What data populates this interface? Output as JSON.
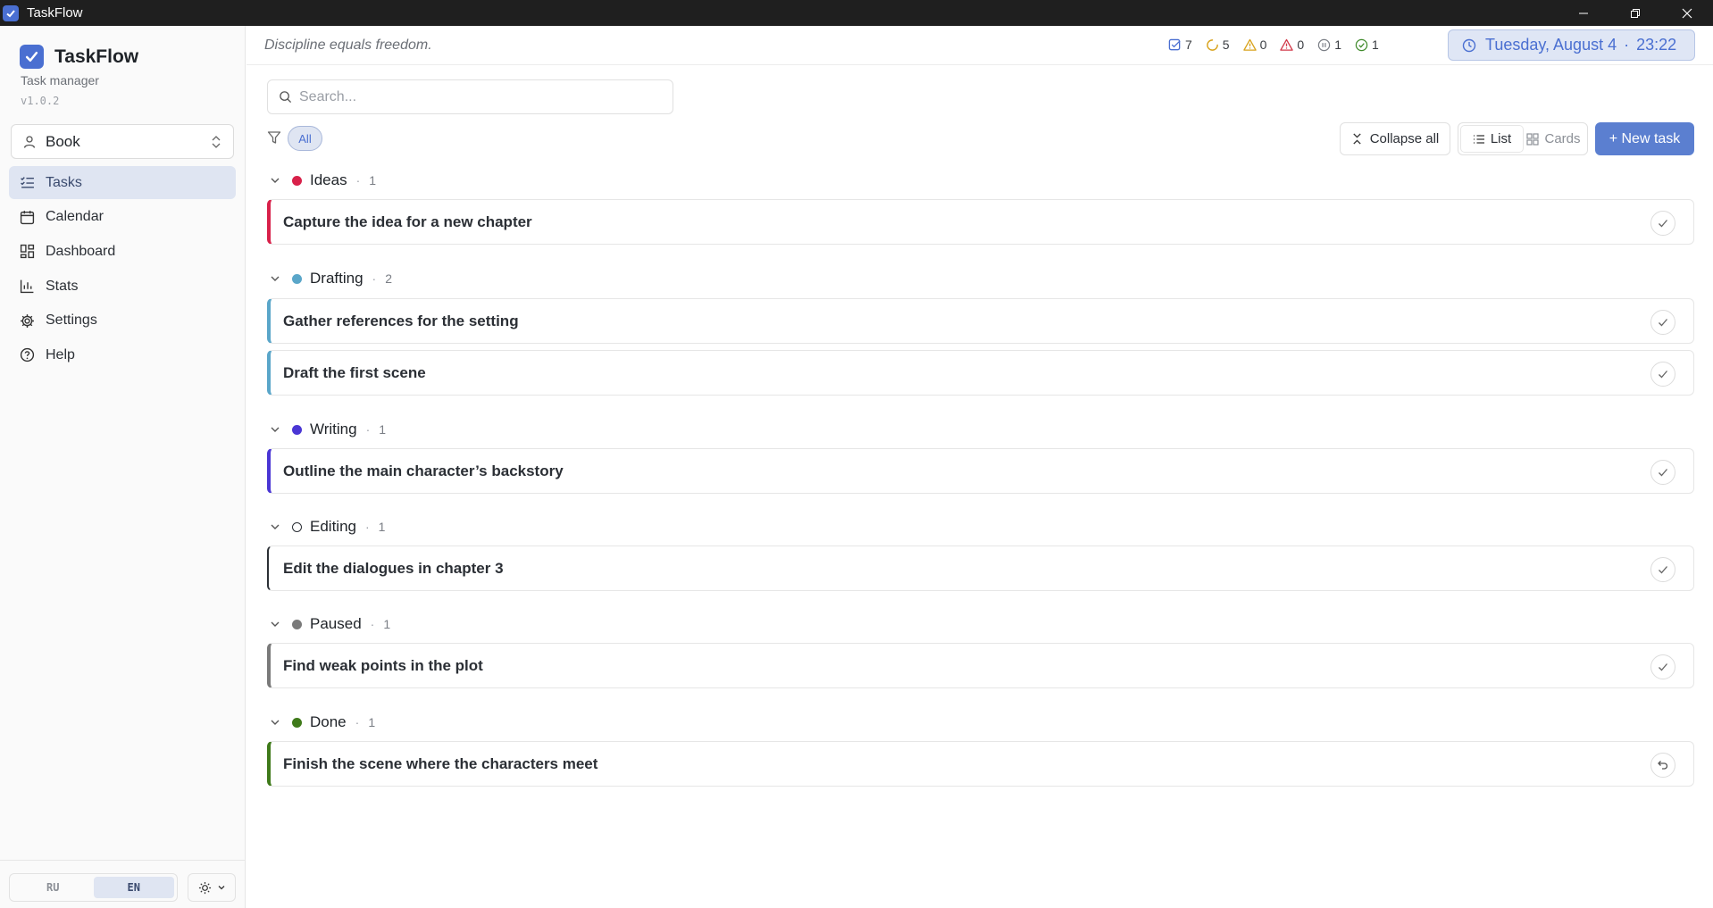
{
  "window": {
    "title": "TaskFlow"
  },
  "sidebar": {
    "app_name": "TaskFlow",
    "subtitle": "Task manager",
    "version": "v1.0.2",
    "project": "Book",
    "nav": [
      {
        "label": "Tasks",
        "icon": "list-check-icon",
        "active": true
      },
      {
        "label": "Calendar",
        "icon": "calendar-icon"
      },
      {
        "label": "Dashboard",
        "icon": "dashboard-icon"
      },
      {
        "label": "Stats",
        "icon": "bar-chart-icon"
      },
      {
        "label": "Settings",
        "icon": "gear-icon"
      },
      {
        "label": "Help",
        "icon": "help-circle-icon"
      }
    ],
    "languages": [
      {
        "code": "RU",
        "active": false
      },
      {
        "code": "EN",
        "active": true
      }
    ]
  },
  "header": {
    "quote": "Discipline equals freedom.",
    "stats": [
      {
        "icon": "checkbox-icon",
        "value": "7",
        "color": "#4a6fd1"
      },
      {
        "icon": "progress-icon",
        "value": "5",
        "color": "#d8a21b"
      },
      {
        "icon": "warning-icon",
        "value": "0",
        "color": "#d8a21b"
      },
      {
        "icon": "alert-icon",
        "value": "0",
        "color": "#d23a4a"
      },
      {
        "icon": "pause-icon",
        "value": "1",
        "color": "#7a7e85"
      },
      {
        "icon": "check-circle-icon",
        "value": "1",
        "color": "#3f8a2a"
      }
    ],
    "date": "Tuesday, August 4",
    "separator": "·",
    "time": "23:22"
  },
  "toolbar": {
    "search_placeholder": "Search...",
    "filter_all": "All",
    "collapse_all": "Collapse all",
    "view_list": "List",
    "view_cards": "Cards",
    "new_task": "+ New task"
  },
  "groups": [
    {
      "name": "Ideas",
      "count": "1",
      "color": "#d8214a",
      "tasks": [
        "Capture the idea for a new chapter"
      ]
    },
    {
      "name": "Drafting",
      "count": "2",
      "color": "#5aa6c9",
      "tasks": [
        "Gather references for the setting",
        "Draft the first scene"
      ]
    },
    {
      "name": "Writing",
      "count": "1",
      "color": "#4a36d4",
      "tasks": [
        "Outline the main character’s backstory"
      ]
    },
    {
      "name": "Editing",
      "count": "1",
      "color": "#2b2f35",
      "tasks": [
        "Edit the dialogues in chapter 3"
      ]
    },
    {
      "name": "Paused",
      "count": "1",
      "color": "#7a7a7a",
      "tasks": [
        "Find weak points in the plot"
      ]
    },
    {
      "name": "Done",
      "count": "1",
      "color": "#3f7a1a",
      "tasks": [
        "Finish the scene where the characters meet"
      ]
    }
  ],
  "group_separator": "·"
}
